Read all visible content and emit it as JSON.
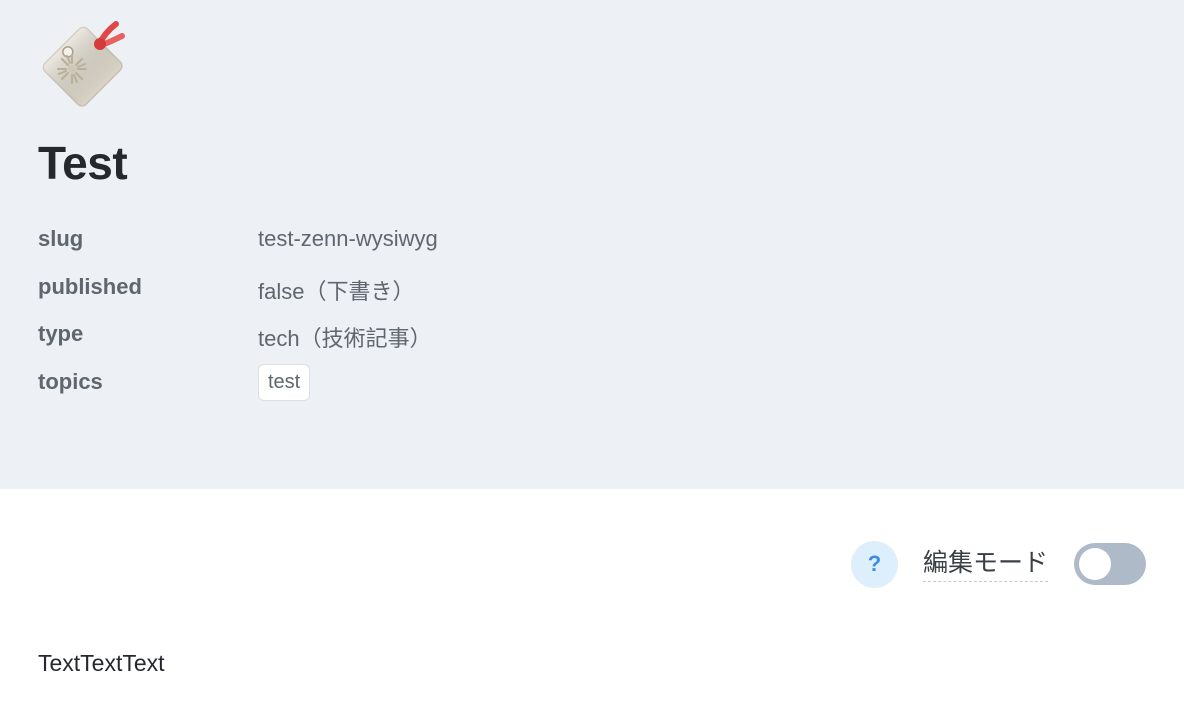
{
  "article": {
    "emoji_icon": "tag-label-icon",
    "title": "Test",
    "meta": [
      {
        "key": "slug",
        "value": "test-zenn-wysiwyg"
      },
      {
        "key": "published",
        "value": "false（下書き）"
      },
      {
        "key": "type",
        "value": "tech（技術記事）"
      },
      {
        "key": "topics",
        "value": ""
      }
    ],
    "topics": [
      "test"
    ]
  },
  "toolbar": {
    "help_label": "?",
    "mode_label": "編集モード",
    "mode_toggle_on": false
  },
  "content": {
    "text": "TextTextText"
  },
  "colors": {
    "header_bg": "#edf1f6",
    "help_bg": "#ddeefc",
    "help_fg": "#3b8ee8",
    "toggle_off": "#aebac7"
  }
}
